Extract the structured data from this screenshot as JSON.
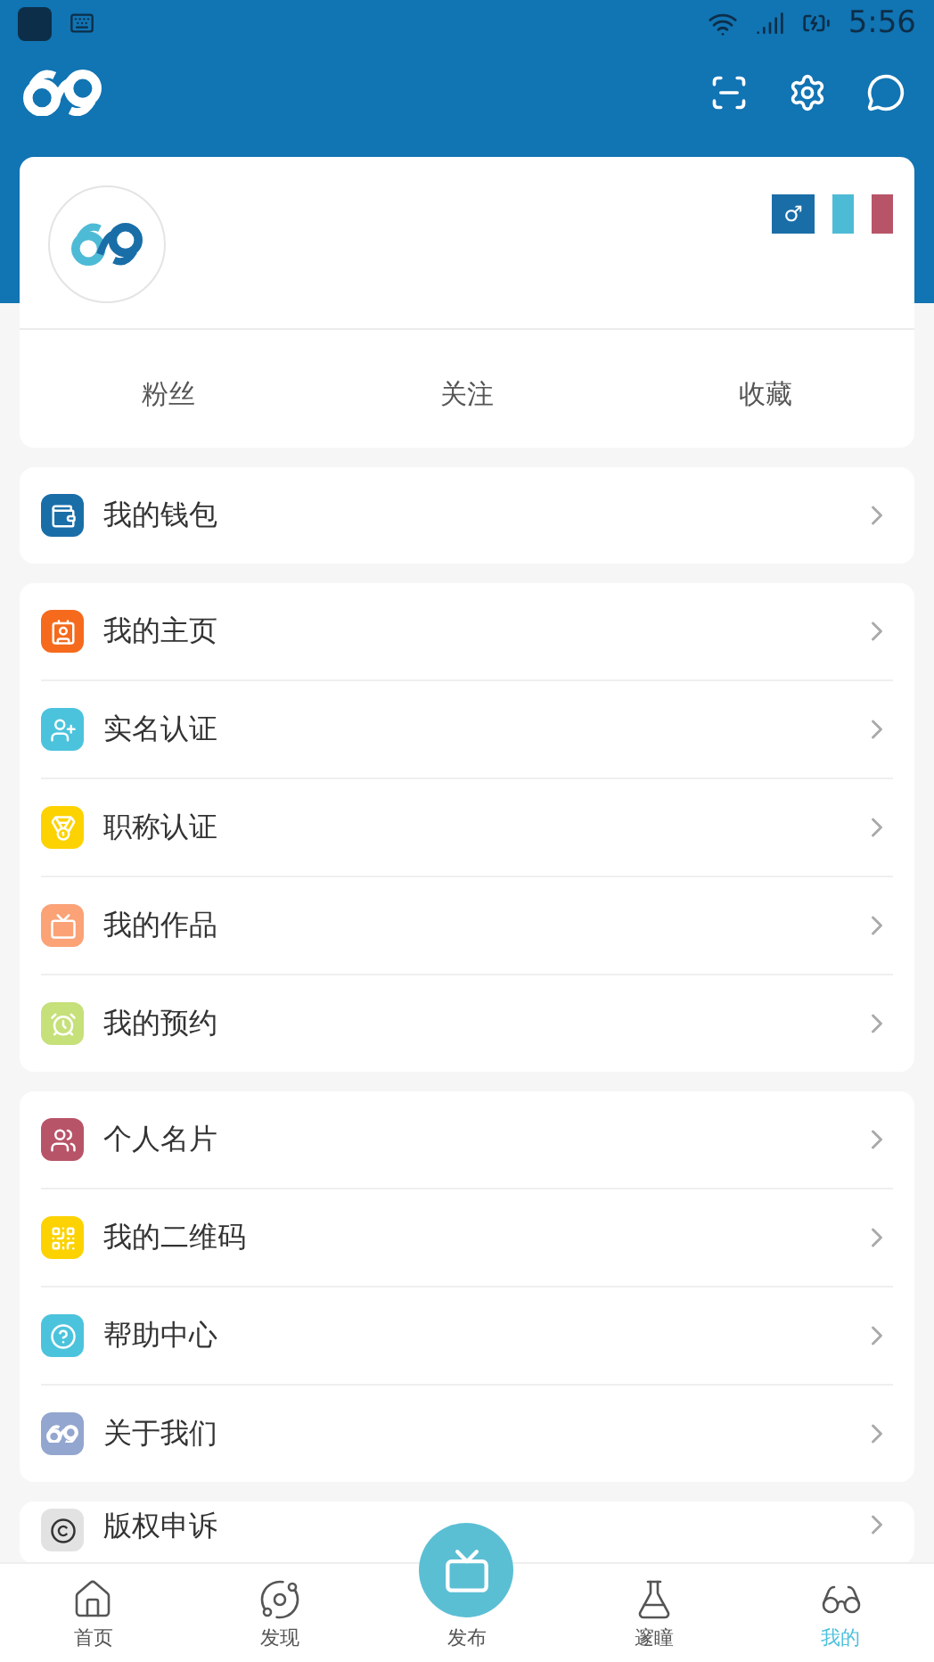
{
  "status_bar": {
    "time": "5:56"
  },
  "profile": {
    "tags": [
      {
        "text": "♂",
        "color": "#1a6ea8"
      },
      {
        "color": "#4ebbd6"
      },
      {
        "color": "#b85468"
      }
    ],
    "stats": [
      "粉丝",
      "关注",
      "收藏"
    ]
  },
  "menu_groups": [
    [
      {
        "label": "我的钱包",
        "color": "#1a6ea8"
      }
    ],
    [
      {
        "label": "我的主页",
        "color": "#f56a1c"
      },
      {
        "label": "实名认证",
        "color": "#4cc3dd"
      },
      {
        "label": "职称认证",
        "color": "#fcd200"
      },
      {
        "label": "我的作品",
        "color": "#fba277"
      },
      {
        "label": "我的预约",
        "color": "#c6e07a"
      }
    ],
    [
      {
        "label": "个人名片",
        "color": "#b85468"
      },
      {
        "label": "我的二维码",
        "color": "#fcd200"
      },
      {
        "label": "帮助中心",
        "color": "#4cc3dd"
      },
      {
        "label": "关于我们",
        "color": "#93a6cf"
      }
    ],
    [
      {
        "label": "版权申诉",
        "color": "#e2e2e2"
      }
    ]
  ],
  "tab_bar": [
    {
      "label": "首页",
      "selected": false
    },
    {
      "label": "发现",
      "selected": false
    },
    {
      "label": "发布",
      "selected": false,
      "kind": "publish"
    },
    {
      "label": "邃瞳",
      "selected": false
    },
    {
      "label": "我的",
      "selected": true
    }
  ]
}
